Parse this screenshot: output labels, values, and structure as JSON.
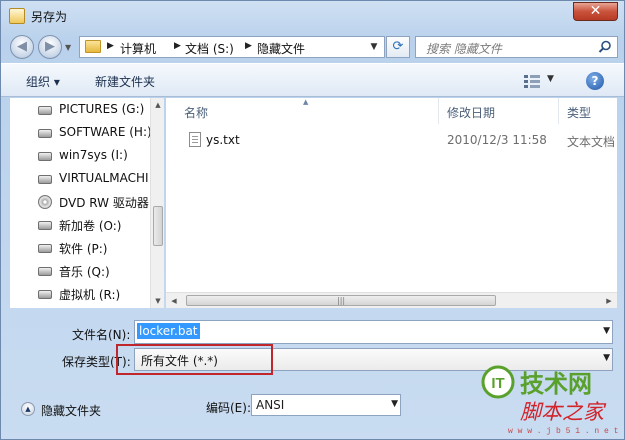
{
  "window": {
    "title": "另存为"
  },
  "address": {
    "crumbs": [
      "计算机",
      "文档 (S:)",
      "隐藏文件"
    ],
    "search_placeholder": "搜索 隐藏文件"
  },
  "toolbar": {
    "organize_label": "组织 ▾",
    "new_folder_label": "新建文件夹"
  },
  "nav": {
    "items": [
      {
        "label": "PICTURES (G:)",
        "icon": "drive-icon"
      },
      {
        "label": "SOFTWARE (H:)",
        "icon": "drive-icon"
      },
      {
        "label": "win7sys (I:)",
        "icon": "drive-icon"
      },
      {
        "label": "VIRTUALMACHI",
        "icon": "drive-icon"
      },
      {
        "label": "DVD RW 驱动器",
        "icon": "dvd-icon"
      },
      {
        "label": "新加卷 (O:)",
        "icon": "drive-icon"
      },
      {
        "label": "软件 (P:)",
        "icon": "drive-icon"
      },
      {
        "label": "音乐 (Q:)",
        "icon": "drive-icon"
      },
      {
        "label": "虚拟机 (R:)",
        "icon": "drive-icon"
      }
    ]
  },
  "files": {
    "columns": [
      "名称",
      "修改日期",
      "类型"
    ],
    "rows": [
      {
        "name": "ys.txt",
        "date": "2010/12/3 11:58",
        "type": "文本文档"
      }
    ]
  },
  "form": {
    "filename_label": "文件名(N):",
    "filename_value": "locker.bat",
    "type_label": "保存类型(T):",
    "type_value": "所有文件  (*.*)",
    "hide_folders_label": "隐藏文件夹",
    "encoding_label": "编码(E):",
    "encoding_value": "ANSI"
  },
  "watermark": {
    "brand": "技术网",
    "sub": "脚本之家",
    "url": "w w w . j b 5 1 . n e t",
    "logo_text": "IT"
  },
  "colors": {
    "accent": "#3399ff",
    "highlight_border": "#c0272d",
    "watermark_green": "#5aa02c",
    "watermark_red": "#d2232a"
  }
}
